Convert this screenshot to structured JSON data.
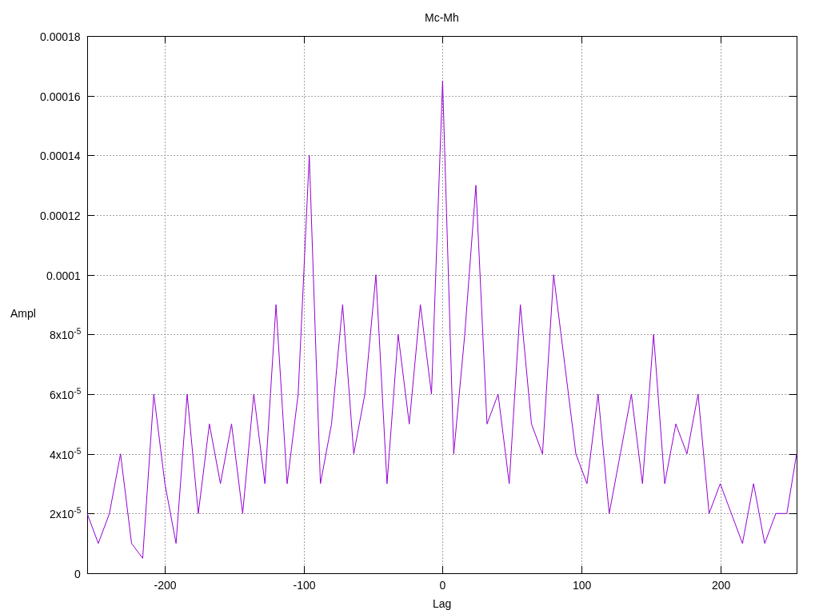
{
  "chart_data": {
    "type": "line",
    "grid": true,
    "title": "Mc-Mh",
    "xlabel": "Lag",
    "ylabel": "Ampl",
    "xlim": [
      -256,
      255
    ],
    "ylim": [
      0,
      0.00018
    ],
    "xticks": [
      -200,
      -100,
      0,
      100,
      200
    ],
    "yticks": [
      {
        "value": 0,
        "label": "0"
      },
      {
        "value": 2e-05,
        "label": "2x10$^{-5}$"
      },
      {
        "value": 4e-05,
        "label": "4x10$^{-5}$"
      },
      {
        "value": 6e-05,
        "label": "6x10$^{-5}$"
      },
      {
        "value": 8e-05,
        "label": "8x10$^{-5}$"
      },
      {
        "value": 0.0001,
        "label": "0.0001"
      },
      {
        "value": 0.00012,
        "label": "0.00012"
      },
      {
        "value": 0.00014,
        "label": "0.00014"
      },
      {
        "value": 0.00016,
        "label": "0.00016"
      },
      {
        "value": 0.00018,
        "label": "0.00018"
      }
    ],
    "x": [
      -256,
      -248,
      -240,
      -232,
      -224,
      -216,
      -208,
      -200,
      -192,
      -184,
      -176,
      -168,
      -160,
      -152,
      -144,
      -136,
      -128,
      -120,
      -112,
      -104,
      -96,
      -88,
      -80,
      -72,
      -64,
      -56,
      -48,
      -40,
      -32,
      -24,
      -16,
      -8,
      0,
      8,
      16,
      24,
      32,
      40,
      48,
      56,
      64,
      72,
      80,
      88,
      96,
      104,
      112,
      120,
      128,
      136,
      144,
      152,
      160,
      168,
      176,
      184,
      192,
      200,
      208,
      216,
      224,
      232,
      240,
      248,
      255
    ],
    "series": [
      {
        "color": "#9400d3",
        "values": [
          2e-05,
          1e-05,
          2e-05,
          4e-05,
          1e-05,
          5e-06,
          6e-05,
          3e-05,
          1e-05,
          6e-05,
          2e-05,
          5e-05,
          3e-05,
          5e-05,
          2e-05,
          6e-05,
          3e-05,
          9e-05,
          3e-05,
          6e-05,
          0.00014,
          3e-05,
          5e-05,
          9e-05,
          4e-05,
          6e-05,
          0.0001,
          3e-05,
          8e-05,
          5e-05,
          9e-05,
          6e-05,
          0.000165,
          4e-05,
          8e-05,
          0.00013,
          5e-05,
          6e-05,
          3e-05,
          9e-05,
          5e-05,
          4e-05,
          0.0001,
          7e-05,
          4e-05,
          3e-05,
          6e-05,
          2e-05,
          4e-05,
          6e-05,
          3e-05,
          8e-05,
          3e-05,
          5e-05,
          4e-05,
          6e-05,
          2e-05,
          3e-05,
          2e-05,
          1e-05,
          3e-05,
          1e-05,
          2e-05,
          2e-05,
          4e-05
        ]
      }
    ]
  }
}
